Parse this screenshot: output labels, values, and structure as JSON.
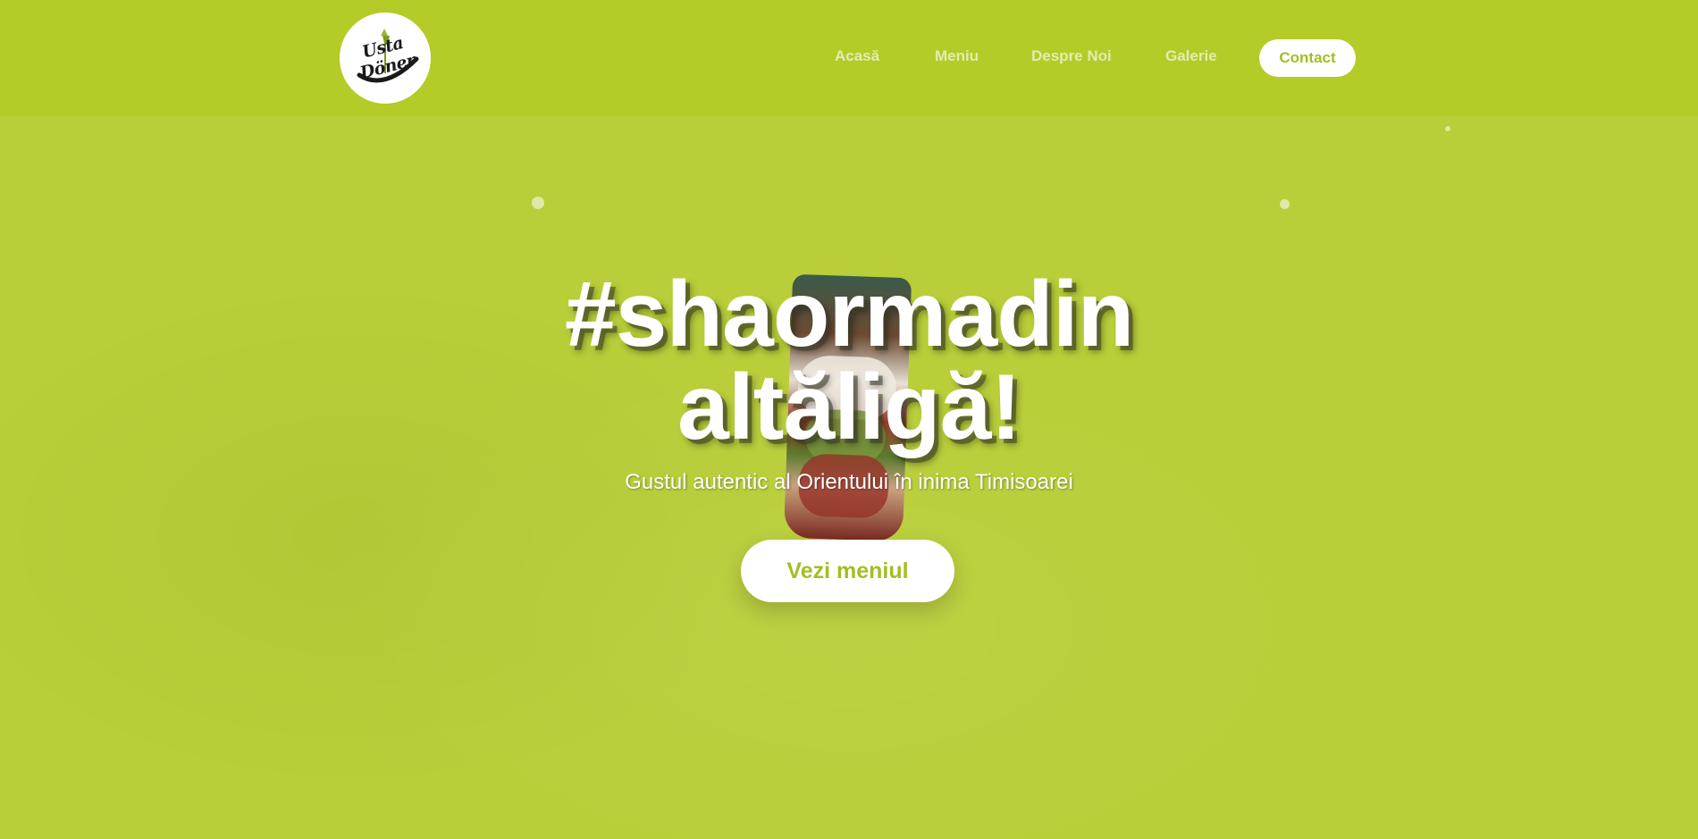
{
  "logo": {
    "text": "Usta Döner",
    "icon": "doner-logo-icon"
  },
  "nav": {
    "items": [
      {
        "label": "Acasă"
      },
      {
        "label": "Meniu"
      },
      {
        "label": "Despre Noi"
      },
      {
        "label": "Galerie"
      }
    ],
    "contact_label": "Contact"
  },
  "hero": {
    "title_line1": "#shaormadin",
    "title_line2": "altăligă!",
    "subtitle": "Gustul autentic al Orientului în inima Timisoarei",
    "cta_label": "Vezi meniul"
  },
  "colors": {
    "accent": "#b4cb28",
    "accent_text": "#a4bd24",
    "nav_text": "#e3ecb2",
    "white": "#ffffff"
  }
}
